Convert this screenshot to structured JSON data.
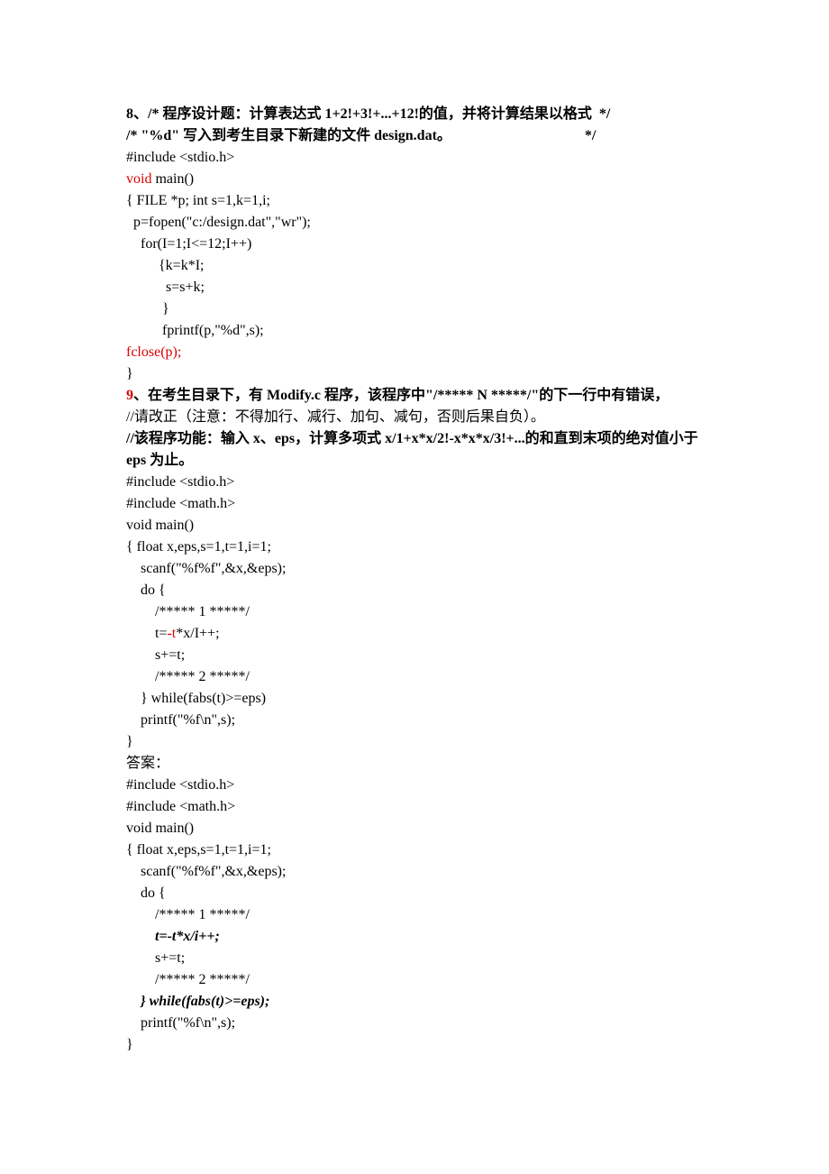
{
  "lines": [
    {
      "segments": [
        {
          "t": "8、/* 程序设计题：计算表达式 1+2!+3!+...+12!的值，并将计算结果以格式  */",
          "cls": "bold"
        }
      ]
    },
    {
      "segments": [
        {
          "t": "/* \"%d\" 写入到考生目录下新建的文件 design.dat。                                     */",
          "cls": "bold"
        }
      ]
    },
    {
      "segments": [
        {
          "t": "#include <stdio.h>"
        }
      ]
    },
    {
      "segments": [
        {
          "t": "void",
          "cls": "red"
        },
        {
          "t": " main()"
        }
      ]
    },
    {
      "segments": [
        {
          "t": "{ FILE *p; int s=1,k=1,i;"
        }
      ]
    },
    {
      "segments": [
        {
          "t": "  p=fopen(\"c:/design.dat\",\"wr\");"
        }
      ]
    },
    {
      "segments": [
        {
          "t": "    for(I=1;I<=12;I++)"
        }
      ]
    },
    {
      "segments": [
        {
          "t": "         {k=k*I;"
        }
      ]
    },
    {
      "segments": [
        {
          "t": "           s=s+k;"
        }
      ]
    },
    {
      "segments": [
        {
          "t": "          }"
        }
      ]
    },
    {
      "segments": [
        {
          "t": "          fprintf(p,\"%d\",s);"
        }
      ]
    },
    {
      "segments": [
        {
          "t": "fclose(p);",
          "cls": "red"
        }
      ]
    },
    {
      "segments": [
        {
          "t": "}"
        }
      ]
    },
    {
      "segments": [
        {
          "t": "9",
          "cls": "bold red"
        },
        {
          "t": "、在考生目录下，有 Modify.c 程序，该程序中\"/***** N *****/\"的下一行中有错误，",
          "cls": "bold"
        }
      ]
    },
    {
      "segments": [
        {
          "t": "//请改正（注意：不得加行、减行、加句、减句，否则后果自负）。"
        }
      ]
    },
    {
      "segments": [
        {
          "t": "//该程序功能：输入 x、eps，计算多项式 x/1+x*x/2!-x*x*x/3!+...的和直到末项的绝对值小于",
          "cls": "bold"
        }
      ]
    },
    {
      "segments": [
        {
          "t": "eps 为止。",
          "cls": "bold"
        }
      ]
    },
    {
      "segments": [
        {
          "t": "#include <stdio.h>"
        }
      ]
    },
    {
      "segments": [
        {
          "t": "#include <math.h>"
        }
      ]
    },
    {
      "segments": [
        {
          "t": "void main()"
        }
      ]
    },
    {
      "segments": [
        {
          "t": "{ float x,eps,s=1,t=1,i=1;"
        }
      ]
    },
    {
      "segments": [
        {
          "t": "    scanf(\"%f%f\",&x,&eps);"
        }
      ]
    },
    {
      "segments": [
        {
          "t": "    do {"
        }
      ]
    },
    {
      "segments": [
        {
          "t": "        /***** 1 *****/"
        }
      ]
    },
    {
      "segments": [
        {
          "t": "        t="
        },
        {
          "t": "-t",
          "cls": "red"
        },
        {
          "t": "*x/I++;"
        }
      ]
    },
    {
      "segments": [
        {
          "t": "        s+=t;"
        }
      ]
    },
    {
      "segments": [
        {
          "t": "        /***** 2 *****/"
        }
      ]
    },
    {
      "segments": [
        {
          "t": "    } while(fabs(t)>=eps)"
        }
      ]
    },
    {
      "segments": [
        {
          "t": "    printf(\"%f\\n\",s);"
        }
      ]
    },
    {
      "segments": [
        {
          "t": "}"
        }
      ]
    },
    {
      "segments": [
        {
          "t": "答案："
        }
      ]
    },
    {
      "segments": [
        {
          "t": "#include <stdio.h>"
        }
      ]
    },
    {
      "segments": [
        {
          "t": "#include <math.h>"
        }
      ]
    },
    {
      "segments": [
        {
          "t": "void main()"
        }
      ]
    },
    {
      "segments": [
        {
          "t": "{ float x,eps,s=1,t=1,i=1;"
        }
      ]
    },
    {
      "segments": [
        {
          "t": "    scanf(\"%f%f\",&x,&eps);"
        }
      ]
    },
    {
      "segments": [
        {
          "t": "    do {"
        }
      ]
    },
    {
      "segments": [
        {
          "t": "        /***** 1 *****/"
        }
      ]
    },
    {
      "segments": [
        {
          "t": "        t=-t*x/i++;",
          "cls": "bolditalic"
        }
      ]
    },
    {
      "segments": [
        {
          "t": "        s+=t;"
        }
      ]
    },
    {
      "segments": [
        {
          "t": "        /***** 2 *****/"
        }
      ]
    },
    {
      "segments": [
        {
          "t": "    } while(fabs(t)>=eps);",
          "cls": "bolditalic"
        }
      ]
    },
    {
      "segments": [
        {
          "t": "    printf(\"%f\\n\",s);"
        }
      ]
    },
    {
      "segments": [
        {
          "t": "}"
        }
      ]
    }
  ]
}
